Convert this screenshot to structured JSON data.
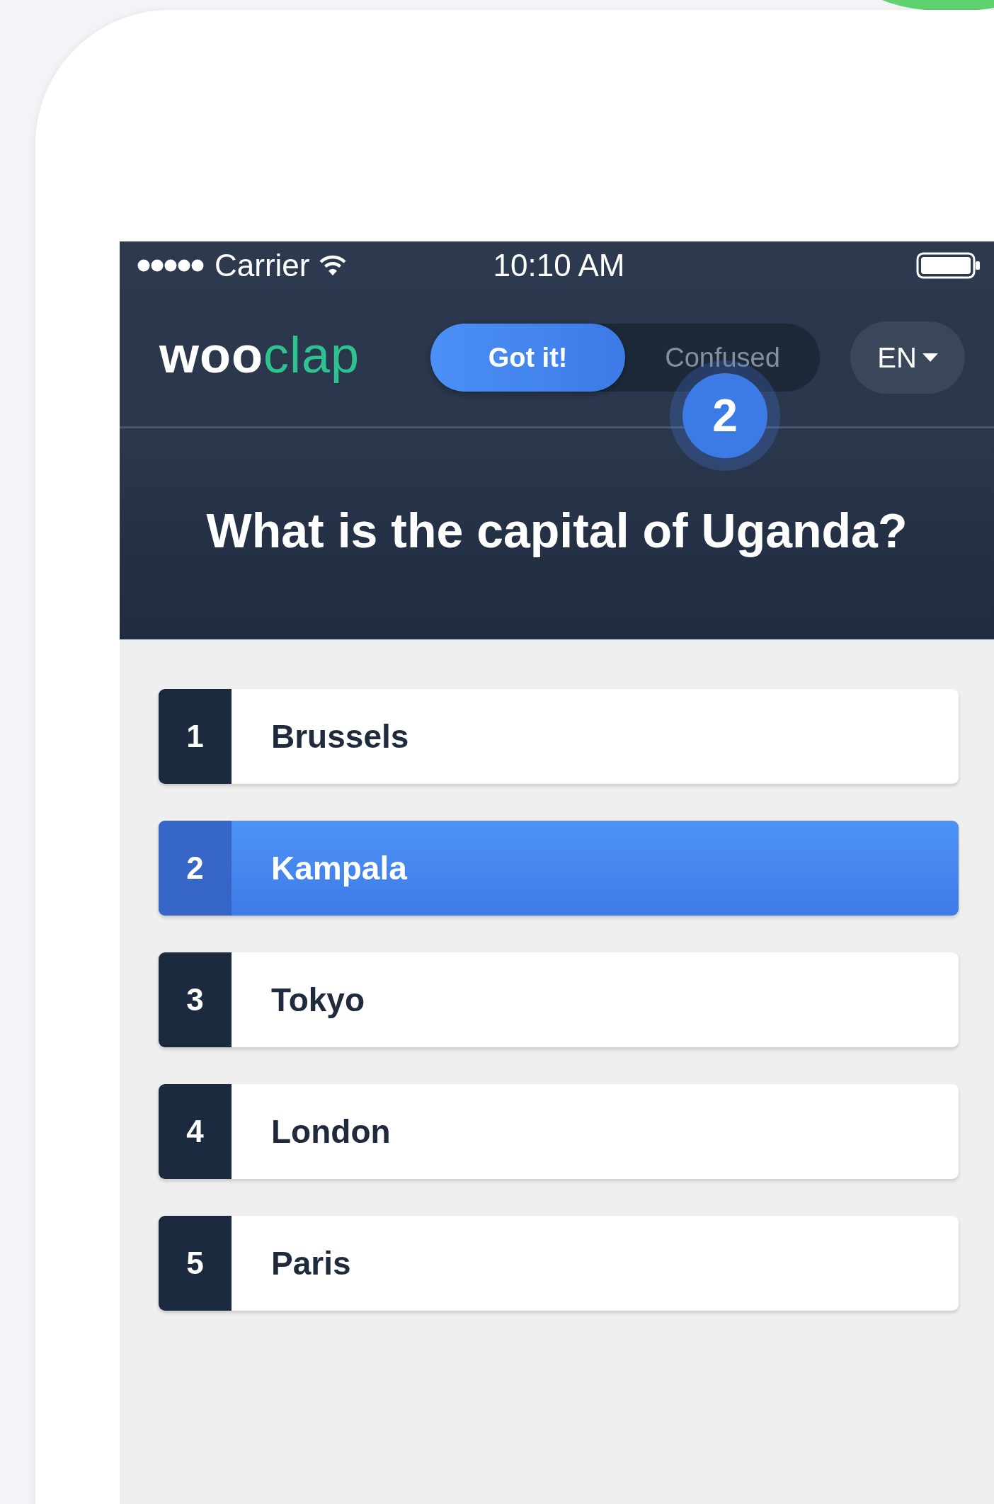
{
  "status_bar": {
    "carrier": "Carrier",
    "time": "10:10 AM"
  },
  "header": {
    "logo": {
      "text_start": "woo",
      "text_end": "clap"
    },
    "feedback_toggle": [
      {
        "label": "Got it!",
        "selected": true
      },
      {
        "label": "Confused",
        "selected": false
      }
    ],
    "count_badge": "2",
    "language": "EN"
  },
  "question": "What is the capital of Uganda?",
  "answers": [
    {
      "number": "1",
      "label": "Brussels",
      "selected": false
    },
    {
      "number": "2",
      "label": "Kampala",
      "selected": true
    },
    {
      "number": "3",
      "label": "Tokyo",
      "selected": false
    },
    {
      "number": "4",
      "label": "London",
      "selected": false
    },
    {
      "number": "5",
      "label": "Paris",
      "selected": false
    }
  ]
}
